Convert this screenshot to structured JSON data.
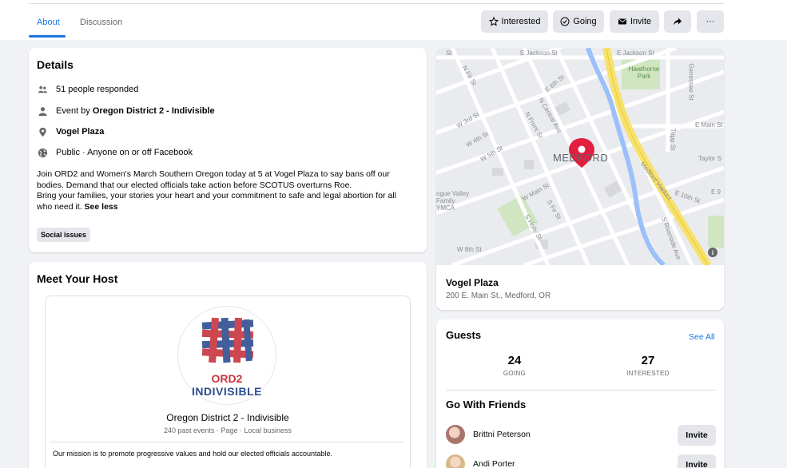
{
  "tabs": [
    {
      "label": "About",
      "active": true
    },
    {
      "label": "Discussion",
      "active": false
    }
  ],
  "actions": {
    "interested": "Interested",
    "going": "Going",
    "invite": "Invite",
    "share_icon": "share-arrow-icon",
    "more": "···"
  },
  "details": {
    "title": "Details",
    "responded": "51 people responded",
    "event_by_prefix": "Event by ",
    "event_by_name": "Oregon District 2 - Indivisible",
    "location": "Vogel Plaza",
    "privacy": "Public · Anyone on or off Facebook",
    "description_line1": "Join ORD2 and Women's March Southern Oregon today at 5 at Vogel Plaza to say bans off our",
    "description_line2": "bodies. Demand that our elected officials take action before SCOTUS overturns Roe.",
    "description_line3": "Bring your families, your stories your heart and your commitment to safe and legal abortion for all",
    "description_line4": "who need it.",
    "see_less": "See less",
    "tag": "Social issues"
  },
  "host": {
    "section_title": "Meet Your Host",
    "logo_text_1": "ORD2",
    "logo_text_2": "INDIVISIBLE",
    "name": "Oregon District 2 - Indivisible",
    "meta": "240 past events · Page · Local business",
    "mission": "Our mission is to promote progressive values and hold our elected officials accountable."
  },
  "map": {
    "labels": {
      "jackson1": "E Jackson St",
      "jackson2": "E Jackson St",
      "st": "St",
      "hawthorne": "Hawthorne Park",
      "genessee": "Genessee St",
      "e6th": "E 6th St",
      "main_e": "E Main St",
      "tripp": "Tripp St",
      "taylor": "Taylor S",
      "w3rd": "W 3rd St",
      "w4th": "W 4th St",
      "w5th": "W 5th St",
      "w8th": "W 8th St",
      "wmain": "W Main St",
      "central": "N Central Ave",
      "front": "N Front St",
      "nfir": "N Fir St",
      "sfir": "S Fir St",
      "sholly": "S Holly St",
      "medford": "MEDFORD",
      "ymca": "ogue Valley Family YMCA",
      "viaduct": "Medford Viaduct",
      "e10th": "E 10th St",
      "e9": "E 9",
      "riverside": "S Riverside Ave"
    },
    "location_name": "Vogel Plaza",
    "address": "200 E. Main St., Medford, OR"
  },
  "guests": {
    "title": "Guests",
    "see_all": "See All",
    "going_count": "24",
    "going_label": "GOING",
    "interested_count": "27",
    "interested_label": "INTERESTED"
  },
  "friends": {
    "title": "Go With Friends",
    "list": [
      {
        "name": "Brittni Peterson",
        "button": "Invite"
      },
      {
        "name": "Andi Porter",
        "button": "Invite"
      }
    ]
  },
  "colors": {
    "accent": "#1b74e4",
    "pin": "#e41e3f",
    "viaduct": "#f7e26b"
  }
}
